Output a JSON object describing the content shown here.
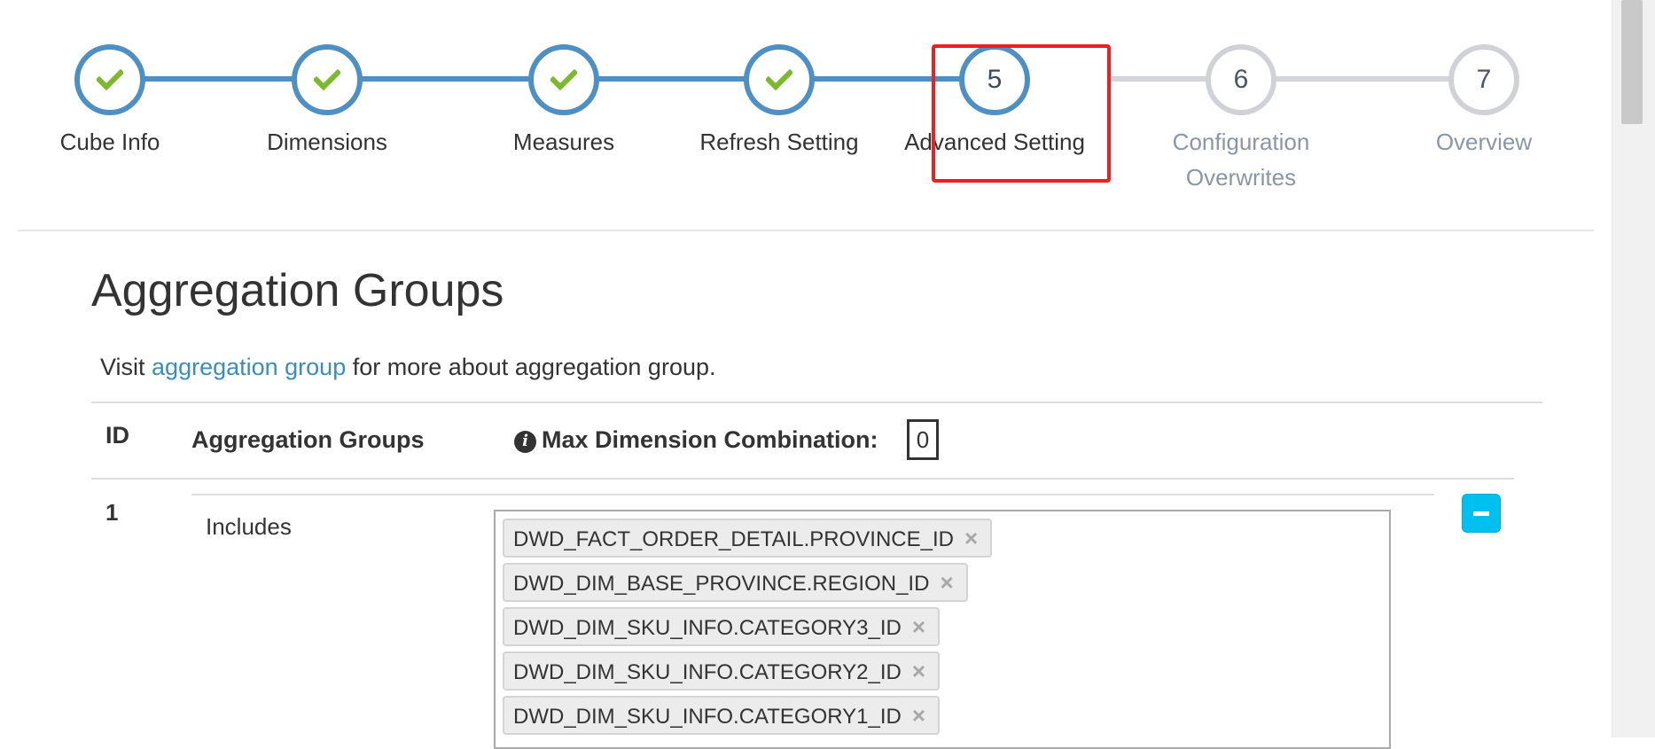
{
  "wizard": {
    "steps": [
      {
        "number": "1",
        "label": "Cube Info",
        "status": "done",
        "icon": "check-icon"
      },
      {
        "number": "2",
        "label": "Dimensions",
        "status": "done",
        "icon": "check-icon"
      },
      {
        "number": "3",
        "label": "Measures",
        "status": "done",
        "icon": "check-icon"
      },
      {
        "number": "4",
        "label": "Refresh Setting",
        "status": "done",
        "icon": "check-icon"
      },
      {
        "number": "5",
        "label": "Advanced Setting",
        "status": "current"
      },
      {
        "number": "6",
        "label_line1": "Configuration",
        "label_line2": "Overwrites",
        "status": "todo"
      },
      {
        "number": "7",
        "label": "Overview",
        "status": "todo"
      }
    ],
    "colors": {
      "done": "#4e8fc4",
      "todo": "#d0d2d6",
      "check": "#7cb92f",
      "highlight": "#f01e1e"
    }
  },
  "section": {
    "title": "Aggregation Groups",
    "visit_prefix": "Visit ",
    "visit_link": "aggregation group",
    "visit_suffix": " for more about aggregation group."
  },
  "table": {
    "headers": {
      "id": "ID",
      "groups": "Aggregation Groups",
      "max_combination": "Max Dimension Combination:"
    },
    "max_combination_value": "0",
    "rows": [
      {
        "id": "1",
        "includes_label": "Includes",
        "includes": [
          "DWD_FACT_ORDER_DETAIL.PROVINCE_ID",
          "DWD_DIM_BASE_PROVINCE.REGION_ID",
          "DWD_DIM_SKU_INFO.CATEGORY3_ID",
          "DWD_DIM_SKU_INFO.CATEGORY2_ID",
          "DWD_DIM_SKU_INFO.CATEGORY1_ID"
        ],
        "remove_tag_glyph": "×"
      }
    ]
  },
  "accent_color": "#00c0ef",
  "link_color": "#3c8dbc"
}
